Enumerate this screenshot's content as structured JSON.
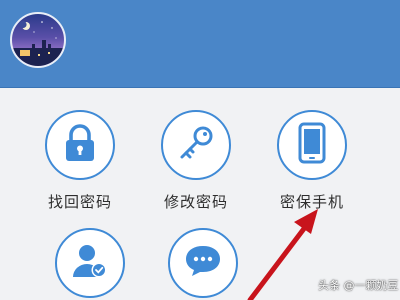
{
  "menu": {
    "items": [
      {
        "label": "找回密码",
        "icon": "lock-icon"
      },
      {
        "label": "修改密码",
        "icon": "key-icon"
      },
      {
        "label": "密保手机",
        "icon": "phone-icon"
      },
      {
        "label": "",
        "icon": "user-verified-icon"
      },
      {
        "label": "",
        "icon": "chat-bubble-icon"
      }
    ]
  },
  "watermark": "头条 @一颗奶豆",
  "colors": {
    "header": "#4a86c8",
    "accent": "#3f8ad6",
    "arrow": "#c8141c",
    "background": "#f1f2f4"
  }
}
